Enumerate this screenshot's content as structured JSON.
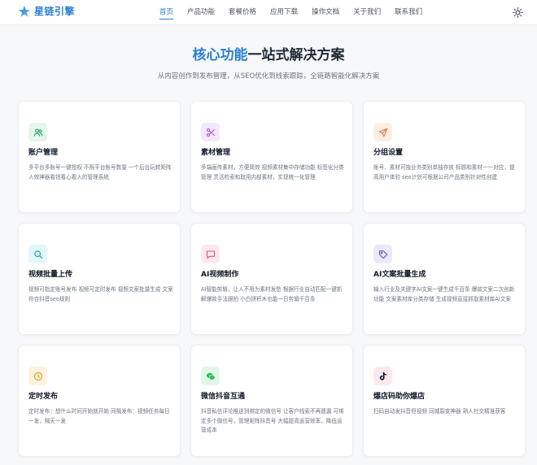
{
  "header": {
    "brand": "星链引擎",
    "nav": [
      "首页",
      "产品功能",
      "套餐价格",
      "应用下载",
      "操作文档",
      "关于我们",
      "联系我们"
    ],
    "active_nav_index": 0,
    "theme_icon": "sun-icon"
  },
  "hero": {
    "title_highlight": "核心功能",
    "title_rest": "一站式解决方案",
    "subtitle": "从内容创作到发布管理，从SEO优化到线索跟踪，全链路智能化解决方案"
  },
  "colors": {
    "accent": "#2b7fd6",
    "green_bg": "#e6f6ec",
    "green": "#22a35a",
    "purple_bg": "#f3e8fb",
    "purple": "#b054d8",
    "orange_bg": "#fdeee3",
    "orange": "#e8794a",
    "teal_bg": "#e3f6f8",
    "teal": "#1aa7b8",
    "pink_bg": "#fde8f0",
    "pink": "#db4f86",
    "violet_bg": "#ece9fb",
    "violet": "#6b5bd2",
    "yellow_bg": "#fdf3de",
    "yellow": "#dfa024",
    "wechat_bg": "#e3f7e8",
    "wechat": "#1fb84f",
    "tiktok_bg": "#fde8ee",
    "tiktok": "#111111"
  },
  "cards": [
    {
      "icon": "users-icon",
      "title": "账户管理",
      "desc": "多平台多账号一键授权 不限平台账号数量 一个后台玩转矩阵 人效神器看钱看心看人的管理系统"
    },
    {
      "icon": "scissors-icon",
      "title": "素材管理",
      "desc": "多端画传素材，方便简效 视频素材集中存储功能 标签化分类管理 灵活检索和取用内部素材，实现统一化管理"
    },
    {
      "icon": "send-icon",
      "title": "分组设置",
      "desc": "账号、素材可按业务类别单独存放 标题和素材一一对应，提高用户体验 seo计划可根据公司产品类别针对性创建"
    },
    {
      "icon": "search-icon",
      "title": "视频批量上传",
      "desc": "视频可指定账号发布 视频可定时发布 视频文案批量生成 文案符合抖音seo规则"
    },
    {
      "icon": "message-icon",
      "title": "AI视频制作",
      "desc": "AI智能剪辑，让人不用为素材发愁 根据行业自动匹配一键抓解爆款手法跟拍 小白拼积木也能一日剪辑千百条"
    },
    {
      "icon": "tag-icon",
      "title": "AI文案批量生成",
      "desc": "输入行业及关键字AI文案一键生成千百条 爆款文案二次创新功能 文案素材库分类存储 生成视频直接抓取素材库AI文案"
    },
    {
      "icon": "clock-icon",
      "title": "定时发布",
      "desc": "定时发布：想什么时间开始就开始 间隔发布：视频任务每日一发，隔天一发"
    },
    {
      "icon": "wechat-icon",
      "title": "微信抖音互通",
      "desc": "抖音私信评论推送到绑定的微信号 让客户线索不再遗漏 可绑定多个微信号，管理矩阵抖音号 大幅提高运营效率，降低运营成本"
    },
    {
      "icon": "tiktok-icon",
      "title": "爆店码助你爆店",
      "desc": "扫码自动发抖音但视频 同城裂变神器 熟人社交精准获客"
    }
  ]
}
